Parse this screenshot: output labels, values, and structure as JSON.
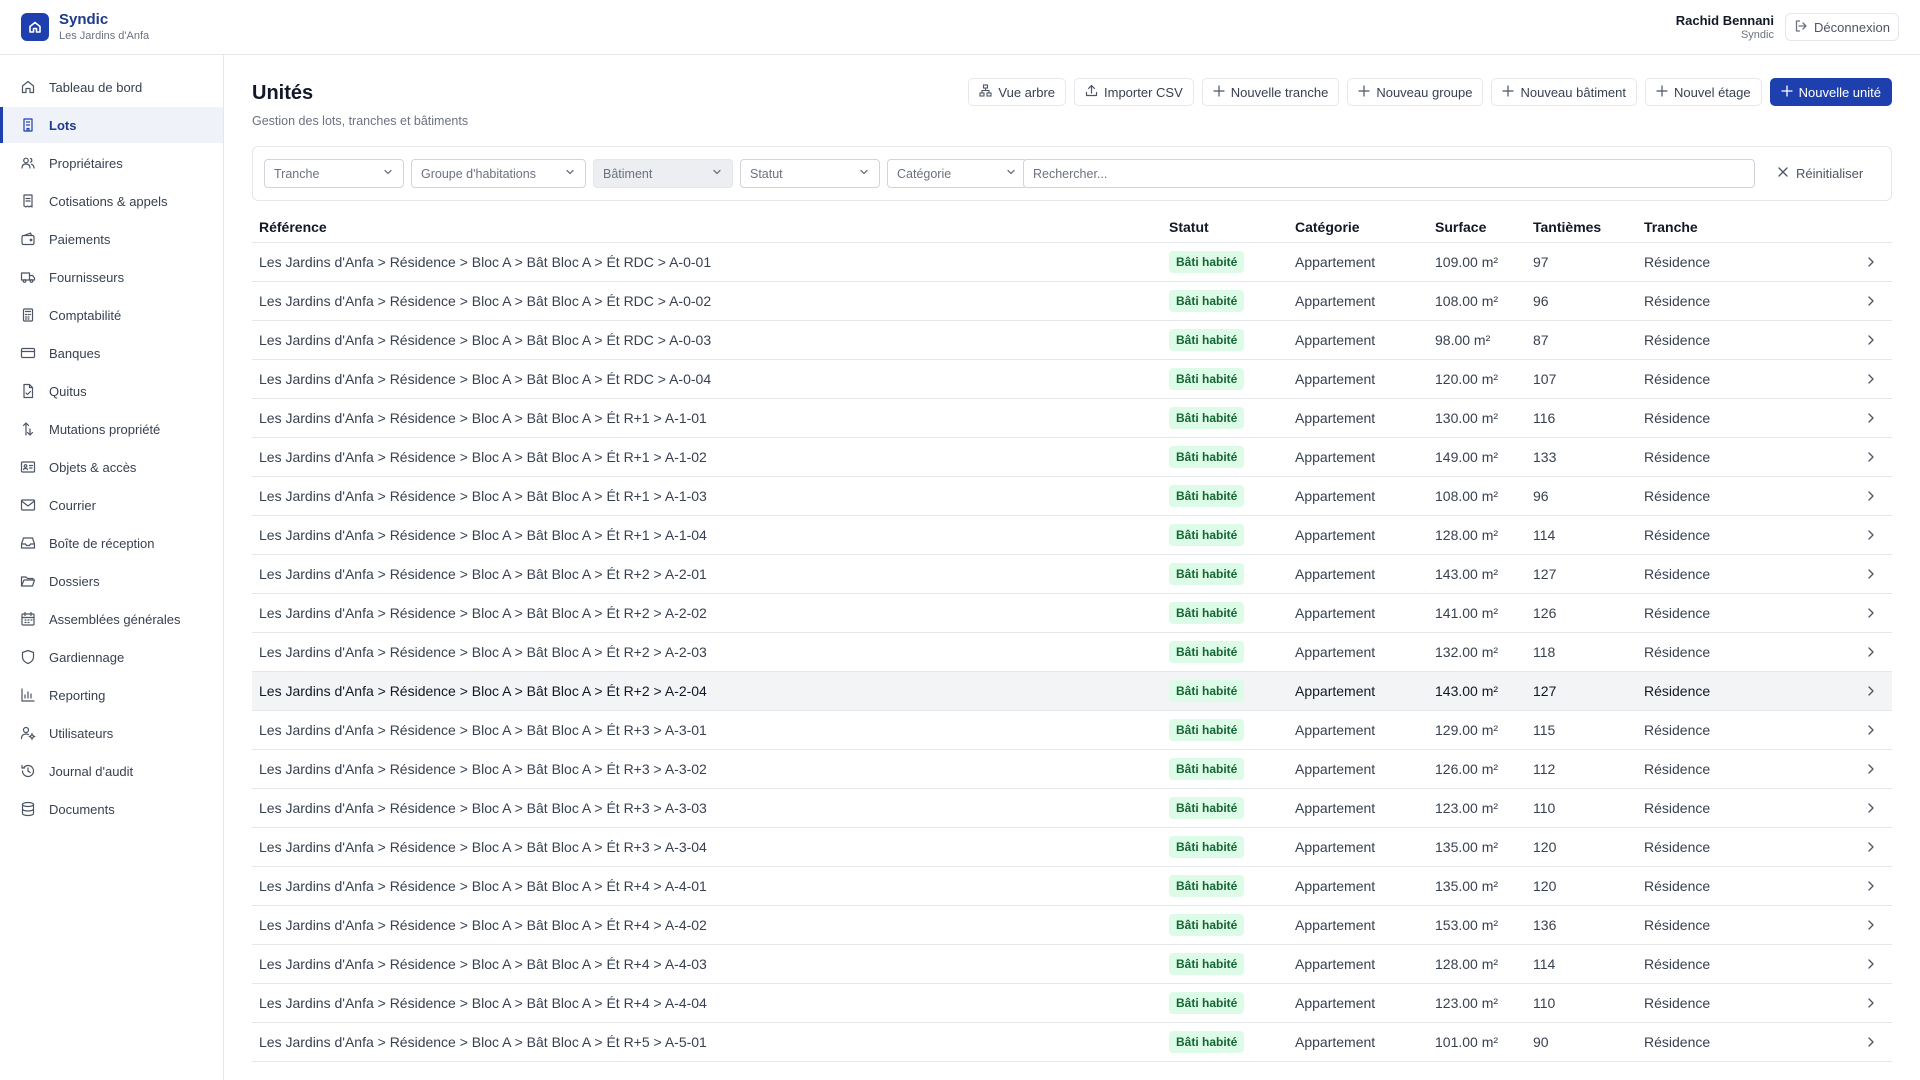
{
  "app": {
    "name": "Syndic",
    "subtitle": "Les Jardins d'Anfa"
  },
  "user": {
    "name": "Rachid Bennani",
    "role": "Syndic",
    "logout_label": "Déconnexion"
  },
  "sidebar": {
    "items": [
      {
        "label": "Tableau de bord",
        "icon": "home-icon"
      },
      {
        "label": "Lots",
        "icon": "building-icon",
        "active": true
      },
      {
        "label": "Propriétaires",
        "icon": "users-icon"
      },
      {
        "label": "Cotisations & appels",
        "icon": "receipt-icon"
      },
      {
        "label": "Paiements",
        "icon": "wallet-icon"
      },
      {
        "label": "Fournisseurs",
        "icon": "truck-icon"
      },
      {
        "label": "Comptabilité",
        "icon": "calculator-icon"
      },
      {
        "label": "Banques",
        "icon": "credit-card-icon"
      },
      {
        "label": "Quitus",
        "icon": "file-check-icon"
      },
      {
        "label": "Mutations propriété",
        "icon": "arrow-up-down-icon"
      },
      {
        "label": "Objets & accès",
        "icon": "id-card-icon"
      },
      {
        "label": "Courrier",
        "icon": "mail-icon"
      },
      {
        "label": "Boîte de réception",
        "icon": "inbox-icon"
      },
      {
        "label": "Dossiers",
        "icon": "folder-open-icon"
      },
      {
        "label": "Assemblées générales",
        "icon": "calendar-icon"
      },
      {
        "label": "Gardiennage",
        "icon": "shield-icon"
      },
      {
        "label": "Reporting",
        "icon": "bar-chart-icon"
      },
      {
        "label": "Utilisateurs",
        "icon": "user-cog-icon"
      },
      {
        "label": "Journal d'audit",
        "icon": "history-icon"
      },
      {
        "label": "Documents",
        "icon": "database-icon"
      }
    ]
  },
  "page": {
    "title": "Unités",
    "subtitle": "Gestion des lots, tranches et bâtiments"
  },
  "toolbar": {
    "tree_view": "Vue arbre",
    "import_csv": "Importer CSV",
    "new_tranche": "Nouvelle tranche",
    "new_group": "Nouveau groupe",
    "new_building": "Nouveau bâtiment",
    "new_floor": "Nouvel étage",
    "new_unit": "Nouvelle unité"
  },
  "filters": {
    "tranche": "Tranche",
    "groupe": "Groupe d'habitations",
    "batiment": "Bâtiment",
    "statut": "Statut",
    "categorie": "Catégorie",
    "search_placeholder": "Rechercher...",
    "reset": "Réinitialiser"
  },
  "table": {
    "headers": [
      "Référence",
      "Statut",
      "Catégorie",
      "Surface",
      "Tantièmes",
      "Tranche"
    ],
    "rows": [
      [
        "Les Jardins d'Anfa > Résidence > Bloc A > Bât Bloc A > Ét RDC > A-0-01",
        "Bâti habité",
        "Appartement",
        "109.00 m²",
        "97",
        "Résidence"
      ],
      [
        "Les Jardins d'Anfa > Résidence > Bloc A > Bât Bloc A > Ét RDC > A-0-02",
        "Bâti habité",
        "Appartement",
        "108.00 m²",
        "96",
        "Résidence"
      ],
      [
        "Les Jardins d'Anfa > Résidence > Bloc A > Bât Bloc A > Ét RDC > A-0-03",
        "Bâti habité",
        "Appartement",
        "98.00 m²",
        "87",
        "Résidence"
      ],
      [
        "Les Jardins d'Anfa > Résidence > Bloc A > Bât Bloc A > Ét RDC > A-0-04",
        "Bâti habité",
        "Appartement",
        "120.00 m²",
        "107",
        "Résidence"
      ],
      [
        "Les Jardins d'Anfa > Résidence > Bloc A > Bât Bloc A > Ét R+1 > A-1-01",
        "Bâti habité",
        "Appartement",
        "130.00 m²",
        "116",
        "Résidence"
      ],
      [
        "Les Jardins d'Anfa > Résidence > Bloc A > Bât Bloc A > Ét R+1 > A-1-02",
        "Bâti habité",
        "Appartement",
        "149.00 m²",
        "133",
        "Résidence"
      ],
      [
        "Les Jardins d'Anfa > Résidence > Bloc A > Bât Bloc A > Ét R+1 > A-1-03",
        "Bâti habité",
        "Appartement",
        "108.00 m²",
        "96",
        "Résidence"
      ],
      [
        "Les Jardins d'Anfa > Résidence > Bloc A > Bât Bloc A > Ét R+1 > A-1-04",
        "Bâti habité",
        "Appartement",
        "128.00 m²",
        "114",
        "Résidence"
      ],
      [
        "Les Jardins d'Anfa > Résidence > Bloc A > Bât Bloc A > Ét R+2 > A-2-01",
        "Bâti habité",
        "Appartement",
        "143.00 m²",
        "127",
        "Résidence"
      ],
      [
        "Les Jardins d'Anfa > Résidence > Bloc A > Bât Bloc A > Ét R+2 > A-2-02",
        "Bâti habité",
        "Appartement",
        "141.00 m²",
        "126",
        "Résidence"
      ],
      [
        "Les Jardins d'Anfa > Résidence > Bloc A > Bât Bloc A > Ét R+2 > A-2-03",
        "Bâti habité",
        "Appartement",
        "132.00 m²",
        "118",
        "Résidence"
      ],
      [
        "Les Jardins d'Anfa > Résidence > Bloc A > Bât Bloc A > Ét R+2 > A-2-04",
        "Bâti habité",
        "Appartement",
        "143.00 m²",
        "127",
        "Résidence"
      ],
      [
        "Les Jardins d'Anfa > Résidence > Bloc A > Bât Bloc A > Ét R+3 > A-3-01",
        "Bâti habité",
        "Appartement",
        "129.00 m²",
        "115",
        "Résidence"
      ],
      [
        "Les Jardins d'Anfa > Résidence > Bloc A > Bât Bloc A > Ét R+3 > A-3-02",
        "Bâti habité",
        "Appartement",
        "126.00 m²",
        "112",
        "Résidence"
      ],
      [
        "Les Jardins d'Anfa > Résidence > Bloc A > Bât Bloc A > Ét R+3 > A-3-03",
        "Bâti habité",
        "Appartement",
        "123.00 m²",
        "110",
        "Résidence"
      ],
      [
        "Les Jardins d'Anfa > Résidence > Bloc A > Bât Bloc A > Ét R+3 > A-3-04",
        "Bâti habité",
        "Appartement",
        "135.00 m²",
        "120",
        "Résidence"
      ],
      [
        "Les Jardins d'Anfa > Résidence > Bloc A > Bât Bloc A > Ét R+4 > A-4-01",
        "Bâti habité",
        "Appartement",
        "135.00 m²",
        "120",
        "Résidence"
      ],
      [
        "Les Jardins d'Anfa > Résidence > Bloc A > Bât Bloc A > Ét R+4 > A-4-02",
        "Bâti habité",
        "Appartement",
        "153.00 m²",
        "136",
        "Résidence"
      ],
      [
        "Les Jardins d'Anfa > Résidence > Bloc A > Bât Bloc A > Ét R+4 > A-4-03",
        "Bâti habité",
        "Appartement",
        "128.00 m²",
        "114",
        "Résidence"
      ],
      [
        "Les Jardins d'Anfa > Résidence > Bloc A > Bât Bloc A > Ét R+4 > A-4-04",
        "Bâti habité",
        "Appartement",
        "123.00 m²",
        "110",
        "Résidence"
      ],
      [
        "Les Jardins d'Anfa > Résidence > Bloc A > Bât Bloc A > Ét R+5 > A-5-01",
        "Bâti habité",
        "Appartement",
        "101.00 m²",
        "90",
        "Résidence"
      ]
    ]
  },
  "colors": {
    "primary": "#1e40af",
    "badge_bg": "#dcfce7",
    "badge_text": "#166534"
  }
}
